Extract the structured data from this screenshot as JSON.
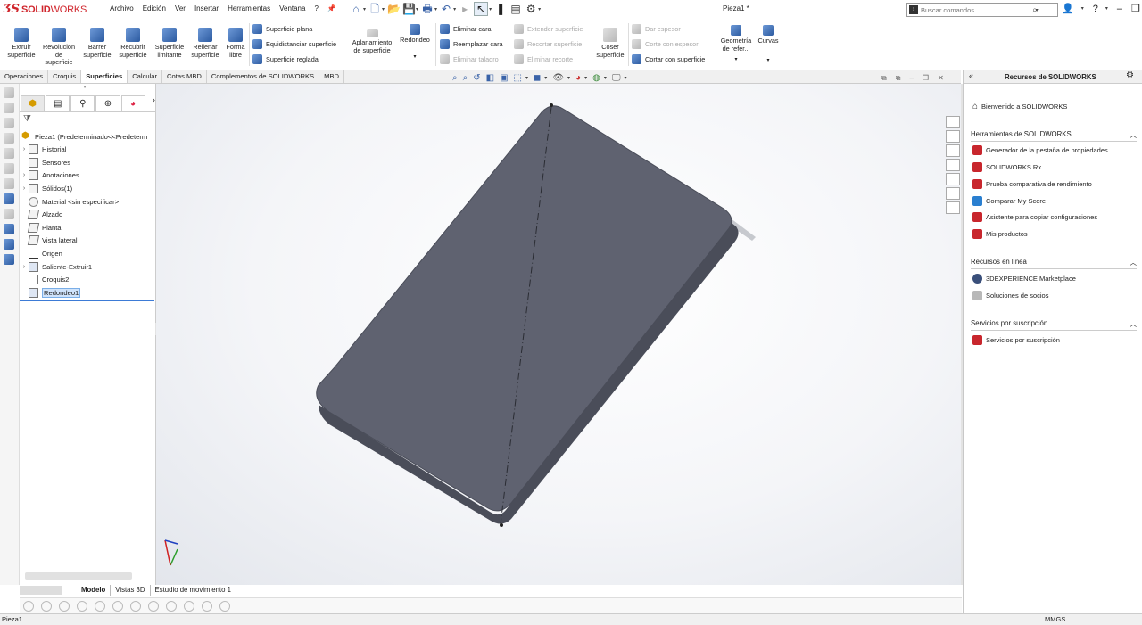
{
  "app": {
    "logo_prefix": "ƷS",
    "logo_bold": "SOLID",
    "logo_rest": "WORKS",
    "document_title": "Pieza1 *"
  },
  "menu": [
    "Archivo",
    "Edición",
    "Ver",
    "Insertar",
    "Herramientas",
    "Ventana",
    "?"
  ],
  "search": {
    "placeholder": "Buscar comandos"
  },
  "ribbon": {
    "large_buttons": [
      {
        "id": "extruir",
        "l1": "Extruir",
        "l2": "superficie",
        "l3": ""
      },
      {
        "id": "revolucion",
        "l1": "Revolución",
        "l2": "de",
        "l3": "superficie"
      },
      {
        "id": "barrer",
        "l1": "Barrer",
        "l2": "superficie",
        "l3": ""
      },
      {
        "id": "recubrir",
        "l1": "Recubrir",
        "l2": "superficie",
        "l3": ""
      },
      {
        "id": "limitante",
        "l1": "Superficie",
        "l2": "limitante",
        "l3": ""
      },
      {
        "id": "rellenar",
        "l1": "Rellenar",
        "l2": "superficie",
        "l3": ""
      },
      {
        "id": "forma",
        "l1": "Forma",
        "l2": "libre",
        "l3": ""
      }
    ],
    "rows_col1": [
      "Superficie plana",
      "Equidistanciar superficie",
      "Superficie reglada"
    ],
    "aplanamiento": {
      "l1": "Aplanamiento",
      "l2": "de superficie"
    },
    "redondeo": "Redondeo",
    "rows_col2": [
      "Eliminar cara",
      "Reemplazar cara",
      "Eliminar taladro"
    ],
    "rows_col3": [
      "Extender superficie",
      "Recortar superficie",
      "Eliminar recorte"
    ],
    "coser": {
      "l1": "Coser",
      "l2": "superficie"
    },
    "rows_col4": [
      "Dar espesor",
      "Corte con espesor",
      "Cortar con superficie"
    ],
    "geometria": {
      "l1": "Geometría",
      "l2": "de refer..."
    },
    "curvas": "Curvas"
  },
  "tabs": [
    {
      "label": "Operaciones",
      "active": false
    },
    {
      "label": "Croquis",
      "active": false
    },
    {
      "label": "Superficies",
      "active": true
    },
    {
      "label": "Calcular",
      "active": false
    },
    {
      "label": "Cotas MBD",
      "active": false
    },
    {
      "label": "Complementos de SOLIDWORKS",
      "active": false
    },
    {
      "label": "MBD",
      "active": false
    }
  ],
  "tree": {
    "root": "Pieza1  (Predeterminado<<Predeterm",
    "items": [
      {
        "label": "Historial",
        "exp": "›"
      },
      {
        "label": "Sensores",
        "exp": ""
      },
      {
        "label": "Anotaciones",
        "exp": "›"
      },
      {
        "label": "Sólidos(1)",
        "exp": "›"
      },
      {
        "label": "Material <sin especificar>",
        "exp": ""
      },
      {
        "label": "Alzado",
        "exp": ""
      },
      {
        "label": "Planta",
        "exp": ""
      },
      {
        "label": "Vista lateral",
        "exp": ""
      },
      {
        "label": "Origen",
        "exp": ""
      },
      {
        "label": "Saliente-Extruir1",
        "exp": "›"
      },
      {
        "label": "Croquis2",
        "exp": ""
      },
      {
        "label": "Redondeo1",
        "exp": "",
        "selected": true
      }
    ]
  },
  "bottom_tabs": [
    {
      "label": "Modelo",
      "active": true
    },
    {
      "label": "Vistas 3D",
      "active": false
    },
    {
      "label": "Estudio de movimiento 1",
      "active": false
    }
  ],
  "status": {
    "left": "Pieza1",
    "units": "MMGS"
  },
  "taskpane": {
    "title": "Recursos de SOLIDWORKS",
    "welcome": "Bienvenido a SOLIDWORKS",
    "sections": [
      {
        "title": "Herramientas de SOLIDWORKS",
        "items": [
          "Generador de la pestaña de propiedades",
          "SOLIDWORKS Rx",
          "Prueba comparativa de rendimiento",
          "Comparar My Score",
          "Asistente para copiar configuraciones",
          "Mis productos"
        ]
      },
      {
        "title": "Recursos en línea",
        "items": [
          "3DEXPERIENCE Marketplace",
          "Soluciones de socios"
        ]
      },
      {
        "title": "Servicios por suscripción",
        "items": [
          "Servicios por suscripción"
        ]
      }
    ]
  },
  "colors": {
    "accent": "#d0262d",
    "part": "#5f6270",
    "part_edge": "#4a4d59",
    "selection": "#cfe3fb"
  }
}
